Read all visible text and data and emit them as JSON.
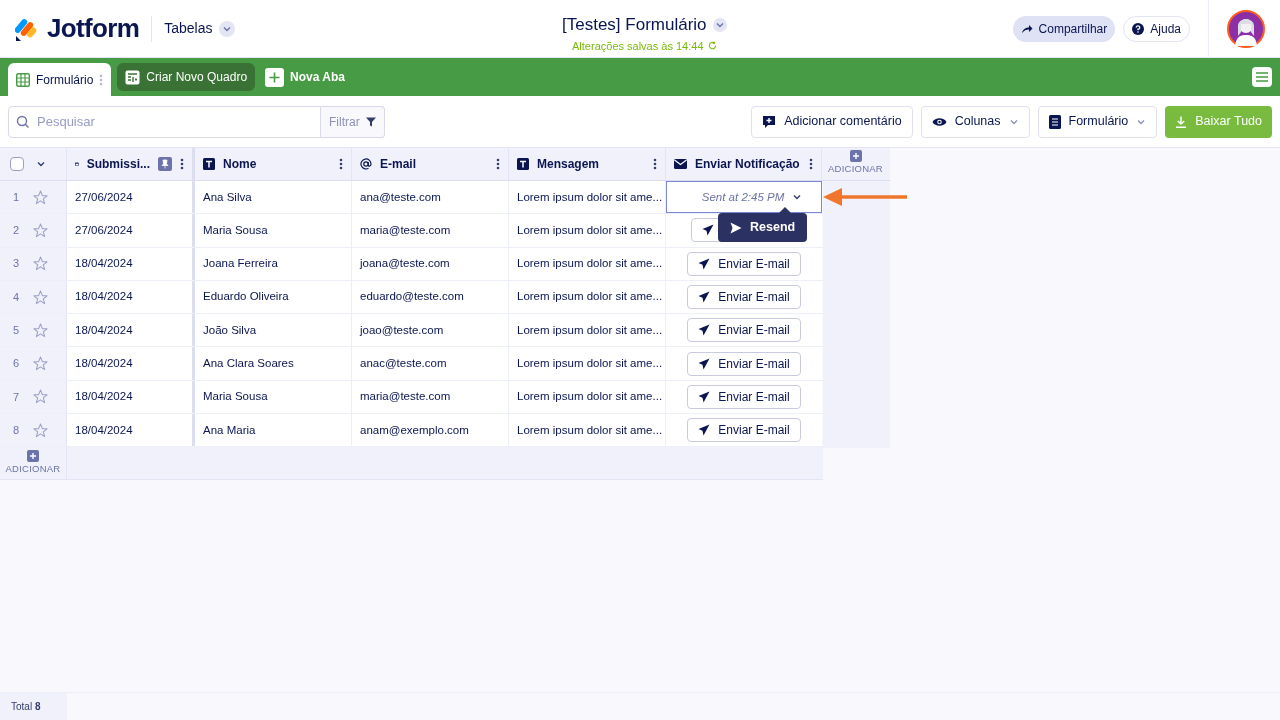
{
  "header": {
    "logo": "Jotform",
    "app_menu": "Tabelas",
    "title": "[Testes] Formulário",
    "save_status": "Alterações salvas às 14:44",
    "buttons": [
      {
        "kind": "share",
        "label": "Compartilhar"
      },
      {
        "kind": "help",
        "label": "Ajuda"
      }
    ]
  },
  "tabs": [
    {
      "kind": "table",
      "label": "Formulário",
      "selected": true
    },
    {
      "kind": "board",
      "label": "Criar Novo Quadro",
      "selected": false
    },
    {
      "kind": "add",
      "label": "Nova Aba",
      "selected": false
    }
  ],
  "toolbar": {
    "search": {
      "placeholder": "Pesquisar"
    },
    "filter": "Filtrar",
    "buttons": [
      {
        "kind": "comment",
        "label": "Adicionar comentário"
      },
      {
        "kind": "columns",
        "label": "Colunas"
      },
      {
        "kind": "form",
        "label": "Formulário"
      },
      {
        "kind": "download",
        "label": "Baixar Tudo"
      }
    ]
  },
  "table": {
    "columns": [
      {
        "kind": "date",
        "label": "Submissi...",
        "pinned": true
      },
      {
        "kind": "text",
        "label": "Nome",
        "pinned": false
      },
      {
        "kind": "email",
        "label": "E-mail",
        "pinned": false
      },
      {
        "kind": "text",
        "label": "Mensagem",
        "pinned": false
      },
      {
        "kind": "mail",
        "label": "Enviar Notificação",
        "pinned": false
      }
    ],
    "select_all": {
      "checked": false
    },
    "add_column": "ADICIONAR",
    "rows": [
      {
        "number": "1",
        "cells": [
          "27/06/2024",
          "Ana Silva",
          "ana@teste.com",
          "Lorem ipsum dolor sit ame..."
        ],
        "notification": {
          "kind": "sent",
          "text": "Sent at 2:45 PM"
        },
        "selected": true
      },
      {
        "number": "2",
        "cells": [
          "27/06/2024",
          "Maria Sousa",
          "maria@teste.com",
          "Lorem ipsum dolor sit ame..."
        ],
        "notification": {
          "kind": "button"
        },
        "selected": false
      },
      {
        "number": "3",
        "cells": [
          "18/04/2024",
          "Joana Ferreira",
          "joana@teste.com",
          "Lorem ipsum dolor sit ame..."
        ],
        "notification": {
          "kind": "button",
          "text": "Enviar E-mail"
        },
        "selected": false
      },
      {
        "number": "4",
        "cells": [
          "18/04/2024",
          "Eduardo Oliveira",
          "eduardo@teste.com",
          "Lorem ipsum dolor sit ame..."
        ],
        "notification": {
          "kind": "button",
          "text": "Enviar E-mail"
        },
        "selected": false
      },
      {
        "number": "5",
        "cells": [
          "18/04/2024",
          "João Silva",
          "joao@teste.com",
          "Lorem ipsum dolor sit ame..."
        ],
        "notification": {
          "kind": "button",
          "text": "Enviar E-mail"
        },
        "selected": false
      },
      {
        "number": "6",
        "cells": [
          "18/04/2024",
          "Ana Clara Soares",
          "anac@teste.com",
          "Lorem ipsum dolor sit ame..."
        ],
        "notification": {
          "kind": "button",
          "text": "Enviar E-mail"
        },
        "selected": false
      },
      {
        "number": "7",
        "cells": [
          "18/04/2024",
          "Maria Sousa",
          "maria@teste.com",
          "Lorem ipsum dolor sit ame..."
        ],
        "notification": {
          "kind": "button",
          "text": "Enviar E-mail"
        },
        "selected": false
      },
      {
        "number": "8",
        "cells": [
          "18/04/2024",
          "Ana Maria",
          "anam@exemplo.com",
          "Lorem ipsum dolor sit ame..."
        ],
        "notification": {
          "kind": "button",
          "text": "Enviar E-mail"
        },
        "selected": false
      }
    ],
    "add_row": "ADICIONAR",
    "popup": {
      "label": "Resend"
    }
  },
  "footer": {
    "total": "Total **8**"
  }
}
